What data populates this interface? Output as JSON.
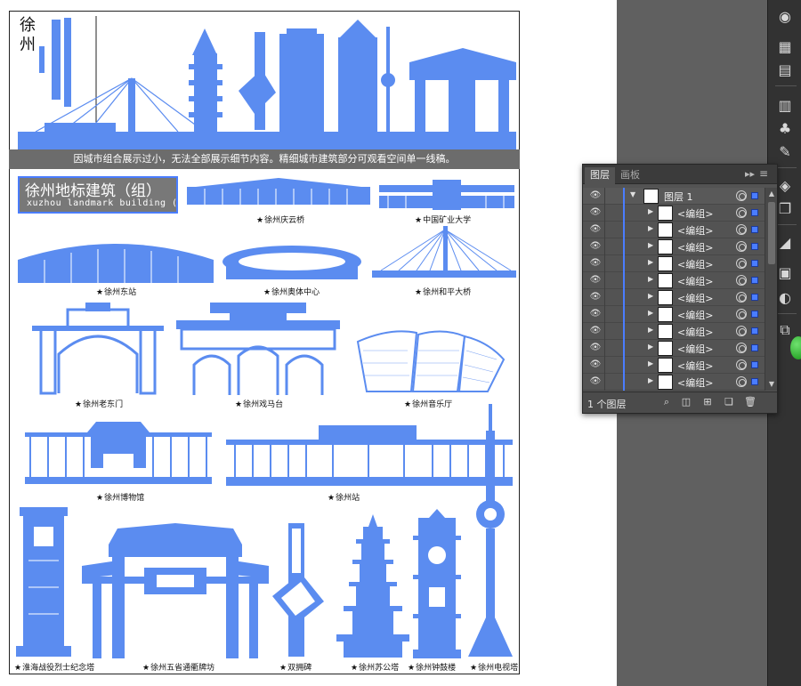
{
  "artboard": {
    "city_vertical": "徐州",
    "banner_note": "因城市组合展示过小，无法全部展示细节内容。精细城市建筑部分可观看空间单一线稿。",
    "title_cn": "徐州地标建筑（组）",
    "title_en": "xuzhou landmark building (1)",
    "landmarks": {
      "qingyun_bridge": "徐州庆云桥",
      "cumt": "中国矿业大学",
      "east_station": "徐州东站",
      "olympic_center": "徐州奥体中心",
      "heping_bridge": "徐州和平大桥",
      "old_east_gate": "徐州老东门",
      "ximatai": "徐州戏马台",
      "concert_hall": "徐州音乐厅",
      "museum": "徐州博物馆",
      "station": "徐州站",
      "martyrs_tower": "淮海战役烈士纪念塔",
      "five_province_arch": "徐州五省通衢牌坊",
      "double_gou": "双拥碑",
      "sugong_tower": "徐州苏公塔",
      "bell_tower": "徐州钟鼓楼",
      "tv_tower": "徐州电视塔"
    },
    "accent_color": "#5b8cf0"
  },
  "layers_panel": {
    "tabs": [
      "图层",
      "画板"
    ],
    "collapse_glyph": "▸▸",
    "menu_glyph": "≡",
    "top_layer": {
      "name": "图层 1",
      "expanded": true
    },
    "sublayers": [
      "<编组>",
      "<编组>",
      "<编组>",
      "<编组>",
      "<编组>",
      "<编组>",
      "<编组>",
      "<编组>",
      "<编组>",
      "<编组>",
      "<编组>"
    ],
    "footer_count": "1 个图层",
    "footer_icons": [
      "search-icon",
      "clip-mask-icon",
      "new-sublayer-icon",
      "new-layer-icon",
      "delete-icon"
    ]
  },
  "tool_strip": {
    "icons": [
      "color-icon",
      "swatches-icon",
      "align-icon",
      "table-icon",
      "symbols-icon",
      "brushes-icon",
      "layers-icon",
      "artboards-icon",
      "gradient-icon",
      "transparency-icon",
      "appearance-icon",
      "links-icon"
    ]
  }
}
